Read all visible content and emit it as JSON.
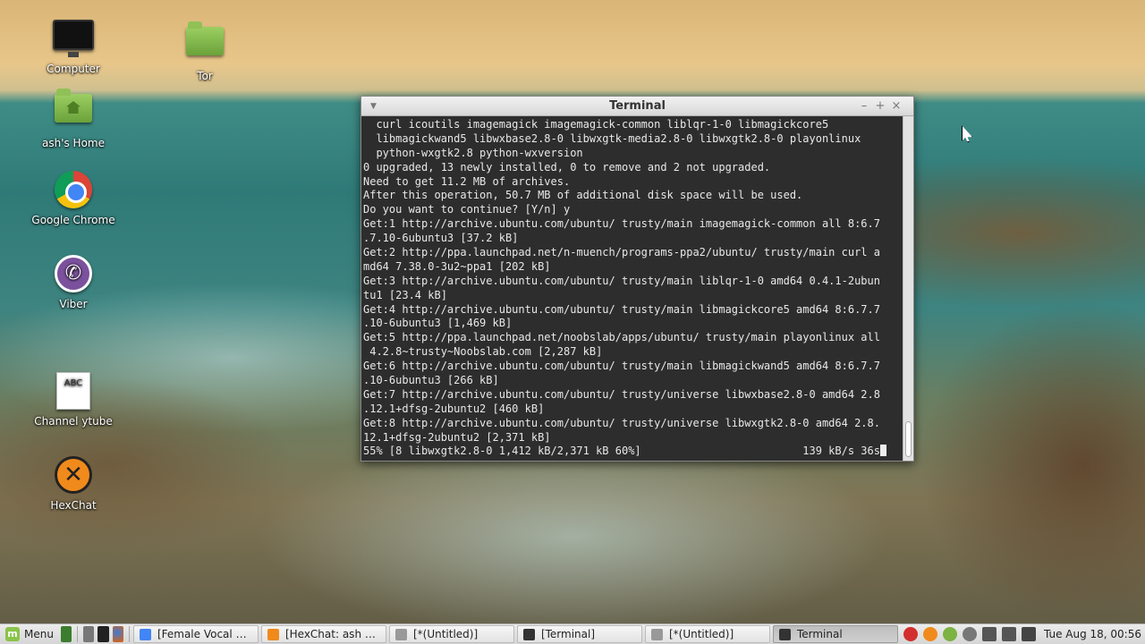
{
  "desktop": {
    "icons": [
      {
        "label": "Computer",
        "glyph": "monitor-icon"
      },
      {
        "label": "Tor",
        "glyph": "folder-icon"
      },
      {
        "label": "ash's Home",
        "glyph": "home-folder-icon"
      },
      {
        "label": "Google Chrome",
        "glyph": "chrome-icon"
      },
      {
        "label": "Viber",
        "glyph": "viber-icon"
      },
      {
        "label": "Channel ytube",
        "glyph": "document-icon",
        "doc_text": "ABC"
      },
      {
        "label": "HexChat",
        "glyph": "hexchat-icon"
      }
    ]
  },
  "terminal": {
    "title": "Terminal",
    "lines": [
      "  curl icoutils imagemagick imagemagick-common liblqr-1-0 libmagickcore5",
      "  libmagickwand5 libwxbase2.8-0 libwxgtk-media2.8-0 libwxgtk2.8-0 playonlinux",
      "  python-wxgtk2.8 python-wxversion",
      "0 upgraded, 13 newly installed, 0 to remove and 2 not upgraded.",
      "Need to get 11.2 MB of archives.",
      "After this operation, 50.7 MB of additional disk space will be used.",
      "Do you want to continue? [Y/n] y",
      "Get:1 http://archive.ubuntu.com/ubuntu/ trusty/main imagemagick-common all 8:6.7",
      ".7.10-6ubuntu3 [37.2 kB]",
      "Get:2 http://ppa.launchpad.net/n-muench/programs-ppa2/ubuntu/ trusty/main curl a",
      "md64 7.38.0-3u2~ppa1 [202 kB]",
      "Get:3 http://archive.ubuntu.com/ubuntu/ trusty/main liblqr-1-0 amd64 0.4.1-2ubun",
      "tu1 [23.4 kB]",
      "Get:4 http://archive.ubuntu.com/ubuntu/ trusty/main libmagickcore5 amd64 8:6.7.7",
      ".10-6ubuntu3 [1,469 kB]",
      "Get:5 http://ppa.launchpad.net/noobslab/apps/ubuntu/ trusty/main playonlinux all",
      " 4.2.8~trusty~Noobslab.com [2,287 kB]",
      "Get:6 http://archive.ubuntu.com/ubuntu/ trusty/main libmagickwand5 amd64 8:6.7.7",
      ".10-6ubuntu3 [266 kB]",
      "Get:7 http://archive.ubuntu.com/ubuntu/ trusty/universe libwxbase2.8-0 amd64 2.8",
      ".12.1+dfsg-2ubuntu2 [460 kB]",
      "Get:8 http://archive.ubuntu.com/ubuntu/ trusty/universe libwxgtk2.8-0 amd64 2.8.",
      "12.1+dfsg-2ubuntu2 [2,371 kB]"
    ],
    "progress_line": "55% [8 libwxgtk2.8-0 1,412 kB/2,371 kB 60%]                         139 kB/s 36s"
  },
  "panel": {
    "menu_label": "Menu",
    "tasks": [
      {
        "label": "[Female Vocal Du...",
        "icon": "chrome-icon",
        "color": "#4285f4",
        "active": false
      },
      {
        "label": "[HexChat: ash @ ...",
        "icon": "hexchat-icon",
        "color": "#f08a1c",
        "active": false
      },
      {
        "label": "[*(Untitled)]",
        "icon": "text-editor-icon",
        "color": "#999999",
        "active": false
      },
      {
        "label": "[Terminal]",
        "icon": "terminal-icon",
        "color": "#333333",
        "active": false
      },
      {
        "label": "[*(Untitled)]",
        "icon": "text-editor-icon",
        "color": "#999999",
        "active": false
      },
      {
        "label": "Terminal",
        "icon": "terminal-icon",
        "color": "#333333",
        "active": true
      }
    ],
    "clock": "Tue Aug 18, 00:56"
  }
}
